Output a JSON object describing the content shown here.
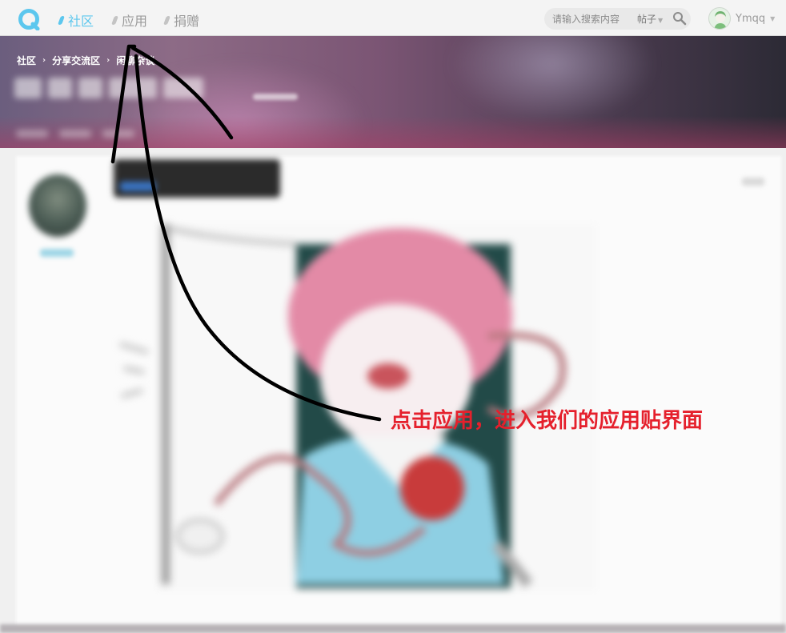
{
  "nav": {
    "items": [
      {
        "label": "社区",
        "active": true
      },
      {
        "label": "应用",
        "active": false
      },
      {
        "label": "捐赠",
        "active": false
      }
    ],
    "logo_icon": "forum-logo-icon"
  },
  "search": {
    "placeholder": "请输入搜索内容",
    "scope": "帖子",
    "icon": "search-icon"
  },
  "user": {
    "name": "Ymqq",
    "avatar_icon": "user-avatar-icon"
  },
  "breadcrumb": {
    "items": [
      "社区",
      "分享交流区",
      "闲聊杂谈"
    ]
  },
  "annotation": {
    "text": "点击应用，进入我们的应用贴界面",
    "color": "#e5202c"
  },
  "colors": {
    "accent": "#5cc7ee",
    "annotation": "#e5202c"
  }
}
